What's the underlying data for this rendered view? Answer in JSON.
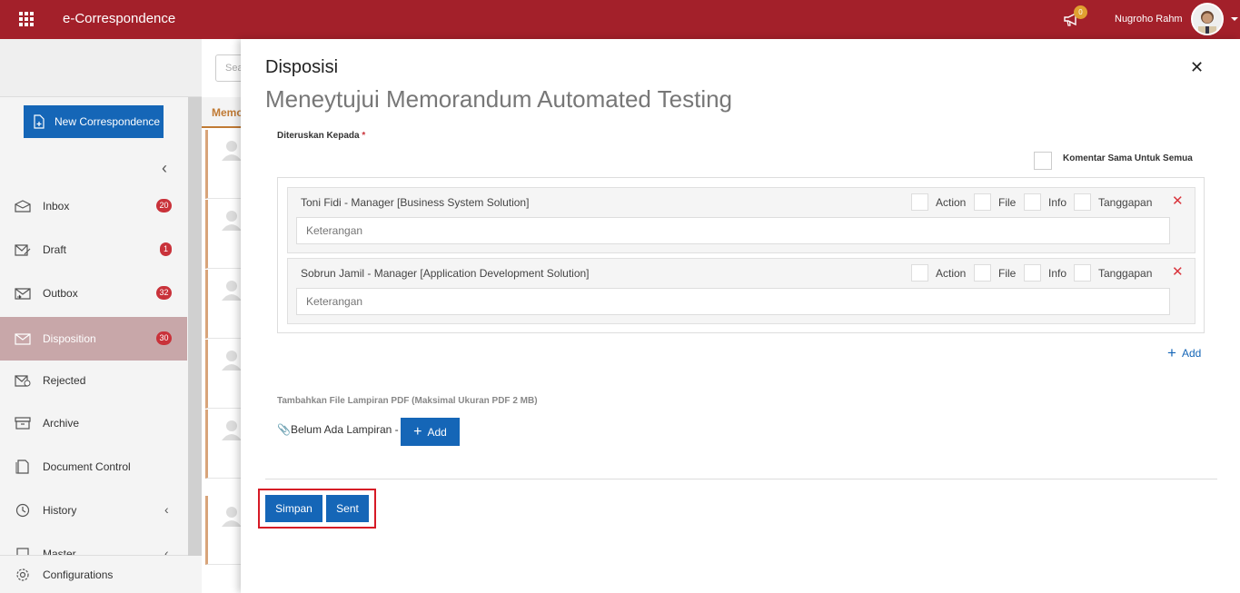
{
  "app": {
    "title": "e-Correspondence",
    "notification_count": "0",
    "user_name": "Nugroho Rahm"
  },
  "sidebar": {
    "new_button": "New Correspondence",
    "items": [
      {
        "label": "Inbox",
        "badge": "20"
      },
      {
        "label": "Draft",
        "badge": "1"
      },
      {
        "label": "Outbox",
        "badge": "32"
      },
      {
        "label": "Disposition",
        "badge": "30"
      },
      {
        "label": "Rejected"
      },
      {
        "label": "Archive"
      },
      {
        "label": "Document Control"
      },
      {
        "label": "History"
      },
      {
        "label": "Master"
      }
    ],
    "bottom": "Configurations"
  },
  "list": {
    "search_placeholder": "Sea",
    "tab_label": "Memo"
  },
  "modal": {
    "title": "Disposisi",
    "subtitle": "Meneytujui Memorandum Automated Testing",
    "to_label": "Diteruskan Kepada",
    "required_mark": "*",
    "same_comment_label": "Komentar Sama Untuk Semua",
    "recipients": [
      {
        "name": "Toni Fidi - Manager [Business System Solution]",
        "note_placeholder": "Keterangan"
      },
      {
        "name": "Sobrun Jamil - Manager [Application Development Solution]",
        "note_placeholder": "Keterangan"
      }
    ],
    "options": {
      "action": "Action",
      "file": "File",
      "info": "Info",
      "tanggapan": "Tanggapan"
    },
    "add_recipient": "Add",
    "attach_label": "Tambahkan File Lampiran PDF (Maksimal Ukuran PDF 2 MB)",
    "attach_status": "Belum Ada Lampiran -",
    "attach_add": "Add",
    "save_button": "Simpan",
    "send_button": "Sent"
  }
}
